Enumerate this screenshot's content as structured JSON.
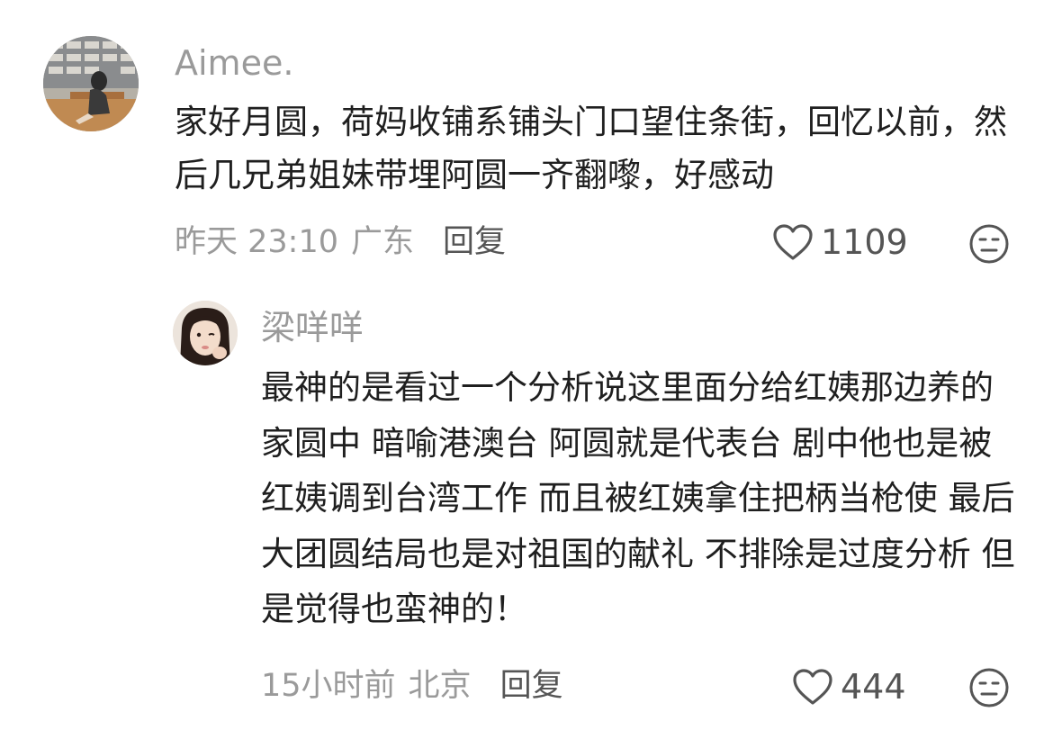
{
  "comments": [
    {
      "author": "Aimee.",
      "text": "家好月圆，荷妈收铺系铺头门口望住条街，回忆以前，然后几兄弟姐妹带埋阿圆一齐翻嚟，好感动",
      "time": "昨天 23:10",
      "location": "广东",
      "reply_label": "回复",
      "likes": "1109"
    },
    {
      "author": "梁咩咩",
      "text": "最神的是看过一个分析说这里面分给红姨那边养的家圆中 暗喻港澳台 阿圆就是代表台 剧中他也是被红姨调到台湾工作 而且被红姨拿住把柄当枪使 最后大团圆结局也是对祖国的献礼 不排除是过度分析 但是觉得也蛮神的！",
      "time": "15小时前",
      "location": "北京",
      "reply_label": "回复",
      "likes": "444"
    }
  ],
  "icons": {
    "like": "heart-outline-icon",
    "dislike": "neutral-face-icon"
  },
  "colors": {
    "author": "#9a9a9a",
    "text": "#1f1f1f",
    "meta": "#9a9a9a",
    "action": "#555555"
  }
}
